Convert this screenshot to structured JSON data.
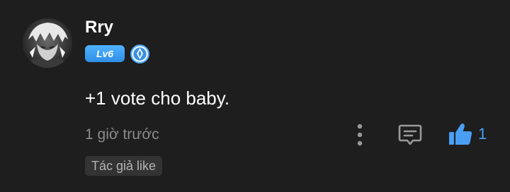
{
  "comment": {
    "username": "Rry",
    "level": "Lv6",
    "text": "+1 vote cho baby.",
    "timestamp": "1 giờ trước",
    "like_count": "1",
    "author_like_label": "Tác giả like"
  },
  "icons": {
    "avatar": "avatar-image",
    "rank": "blue-crystal-badge-icon",
    "more": "more-vertical-icon",
    "reply": "comment-bubble-icon",
    "like": "thumbs-up-icon"
  },
  "colors": {
    "background": "#1e1e1e",
    "level_badge": "#3b9cf2",
    "like_accent": "#4a9ff5",
    "muted_text": "#8c8c8c",
    "badge_bg": "#333333"
  }
}
